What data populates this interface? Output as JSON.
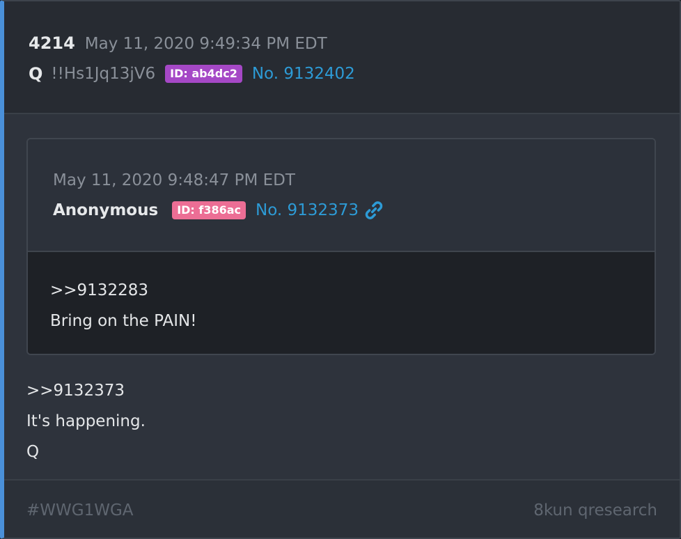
{
  "post": {
    "number": "4214",
    "date": "May 11, 2020 9:49:34 PM EDT",
    "author": "Q",
    "tripcode": "!!Hs1Jq13jV6",
    "id_badge": "ID: ab4dc2",
    "post_link": "No. 9132402",
    "id_badge_color": "#a548c6"
  },
  "quoted_post": {
    "date": "May 11, 2020 9:48:47 PM EDT",
    "author": "Anonymous",
    "id_badge": "ID: f386ac",
    "post_link": "No. 9132373",
    "link_icon": "link-icon",
    "id_badge_color": "#ec6e95",
    "body_lines": [
      ">>9132283",
      "Bring on the PAIN!"
    ]
  },
  "body_lines": [
    ">>9132373",
    "It's happening.",
    "Q"
  ],
  "footer": {
    "hashtag": "#WWG1WGA",
    "source": "8kun qresearch"
  },
  "colors": {
    "accent_border": "#4a90d9",
    "link": "#2d9bd6"
  }
}
